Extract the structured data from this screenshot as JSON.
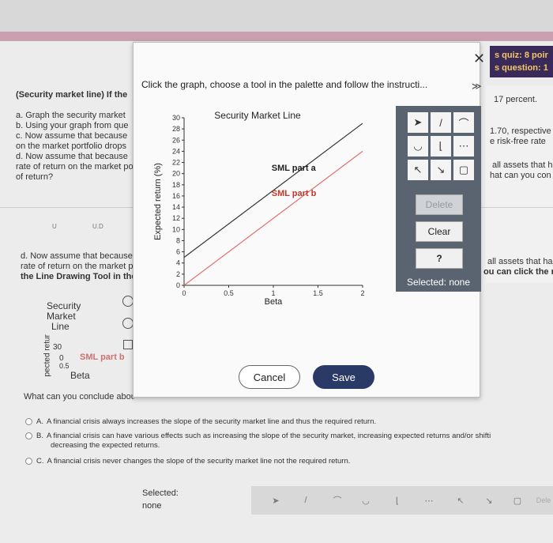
{
  "quiz": {
    "line1": "s quiz: 8 poir",
    "line2": "s question: 1"
  },
  "problem": {
    "heading": "(Security market line) If the",
    "tail_right": "17 percent.",
    "parts": [
      "a. Graph the security market",
      "b. Using your graph from que",
      "c. Now assume that because",
      "on the market portfolio drops",
      "d. Now assume that because",
      "rate of return on the market po",
      "of return?"
    ],
    "right_c1": "1.70, respective",
    "right_c2": "e risk-free rate",
    "right_d1": "all assets that h",
    "right_d2": "hat can you con",
    "u_label": "U",
    "ub_label": "U.D",
    "d_repeat": [
      "d. Now assume that because",
      "rate of return on the market po",
      "the Line Drawing Tool in the"
    ],
    "right_d3": "all assets that ha",
    "right_d4": "ou can click the r",
    "conclude": "What can you conclude about"
  },
  "thumb": {
    "title_lines": [
      "Security",
      "Market",
      "Line"
    ],
    "ylabel": "pected retur",
    "tick_top": "30",
    "tick_zero": "0",
    "tick_x": "0.5",
    "series": "SML part b",
    "xlabel": "Beta"
  },
  "modal": {
    "instructions": "Click the graph, choose a tool in the palette and follow the instructi...",
    "close_symbol": "✕",
    "chevron_symbol": "≫",
    "cancel_label": "Cancel",
    "save_label": "Save",
    "delete_label": "Delete",
    "clear_label": "Clear",
    "help_label": "?",
    "selected_status": "Selected: none"
  },
  "palette_tools": [
    {
      "icon": "pointer-icon",
      "glyph": "➤"
    },
    {
      "icon": "line-tool-icon",
      "glyph": "/"
    },
    {
      "icon": "curve-tool-icon",
      "glyph": "⌒"
    },
    {
      "icon": "curve-up-icon",
      "glyph": "◡"
    },
    {
      "icon": "vertical-curve-icon",
      "glyph": "⌊"
    },
    {
      "icon": "dotted-line-icon",
      "glyph": "⋯"
    },
    {
      "icon": "arrow-line-icon",
      "glyph": "↖"
    },
    {
      "icon": "arrow-line-down-icon",
      "glyph": "↘"
    },
    {
      "icon": "rectangle-icon",
      "glyph": "▢"
    },
    {
      "icon": "triangle-icon",
      "glyph": "◺"
    }
  ],
  "chart_data": {
    "type": "line",
    "title": "Security Market Line",
    "xlabel": "Beta",
    "ylabel": "Expected return (%)",
    "xlim": [
      0,
      2
    ],
    "ylim": [
      0,
      30
    ],
    "xticks": [
      "0",
      "0.5",
      "1",
      "1.5",
      "2"
    ],
    "yticks": [
      "0",
      "2",
      "4",
      "6",
      "8",
      "10",
      "12",
      "14",
      "16",
      "18",
      "20",
      "22",
      "24",
      "26",
      "28",
      "30"
    ],
    "series": [
      {
        "name": "SML part a",
        "color": "#333333",
        "x": [
          0,
          2
        ],
        "y": [
          5,
          29
        ]
      },
      {
        "name": "SML part b",
        "color": "#e07070",
        "x": [
          0,
          2
        ],
        "y": [
          0,
          24
        ]
      }
    ],
    "grid": false
  },
  "choices": [
    {
      "letter": "A.",
      "text": "A financial crisis always increases the slope of the security market line and thus the required return."
    },
    {
      "letter": "B.",
      "text": "A financial crisis can have various effects such as increasing the slope of the security market, increasing expected returns and/or shifti"
    },
    {
      "letter": "",
      "text": "decreasing the expected returns."
    },
    {
      "letter": "C.",
      "text": "A financial crisis never changes the slope of the security market line not the required return."
    }
  ],
  "bottom": {
    "selected_label": "Selected:",
    "selected_value": "none",
    "delete_label": "Dele"
  }
}
